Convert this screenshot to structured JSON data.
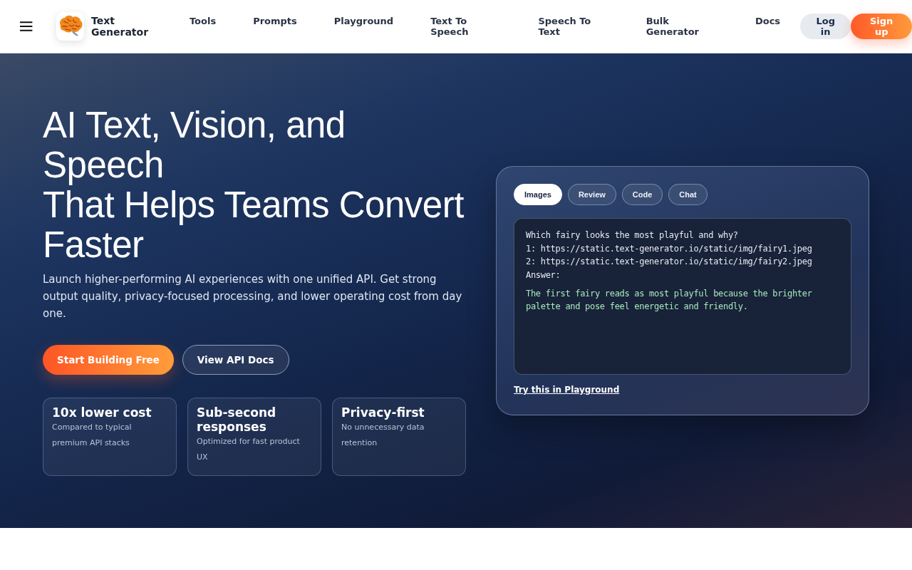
{
  "header": {
    "brand": "Text Generator",
    "nav": [
      "Tools",
      "Prompts",
      "Playground",
      "Text To Speech",
      "Speech To Text",
      "Bulk Generator",
      "Docs"
    ],
    "login": "Log in",
    "signup": "Sign up"
  },
  "hero": {
    "title_lines": [
      "AI Text, Vision, and Speech",
      "That Helps Teams Convert",
      "Faster"
    ],
    "subtitle": "Launch higher-performing AI experiences with one unified API. Get strong output quality, privacy-focused processing, and lower operating cost from day one.",
    "primary_button": "Start Building Free",
    "secondary_button": "View API Docs",
    "features": [
      {
        "title": "10x lower cost",
        "text": "Compared to typical premium API stacks"
      },
      {
        "title": "Sub-second responses",
        "text": "Optimized for fast product UX"
      },
      {
        "title": "Privacy-first",
        "text": "No unnecessary data retention"
      }
    ]
  },
  "demo": {
    "tabs": [
      {
        "label": "Images",
        "selected": true
      },
      {
        "label": "Review",
        "selected": false
      },
      {
        "label": "Code",
        "selected": false
      },
      {
        "label": "Chat",
        "selected": false
      }
    ],
    "prompt_lines": [
      "Which fairy looks the most playful and why?",
      "1: https://static.text-generator.io/static/img/fairy1.jpeg",
      "2: https://static.text-generator.io/static/img/fairy2.jpeg",
      "Answer:"
    ],
    "answer": "The first fairy reads as most playful because the brighter palette and pose feel energetic and friendly.",
    "link": "Try this in Playground"
  }
}
